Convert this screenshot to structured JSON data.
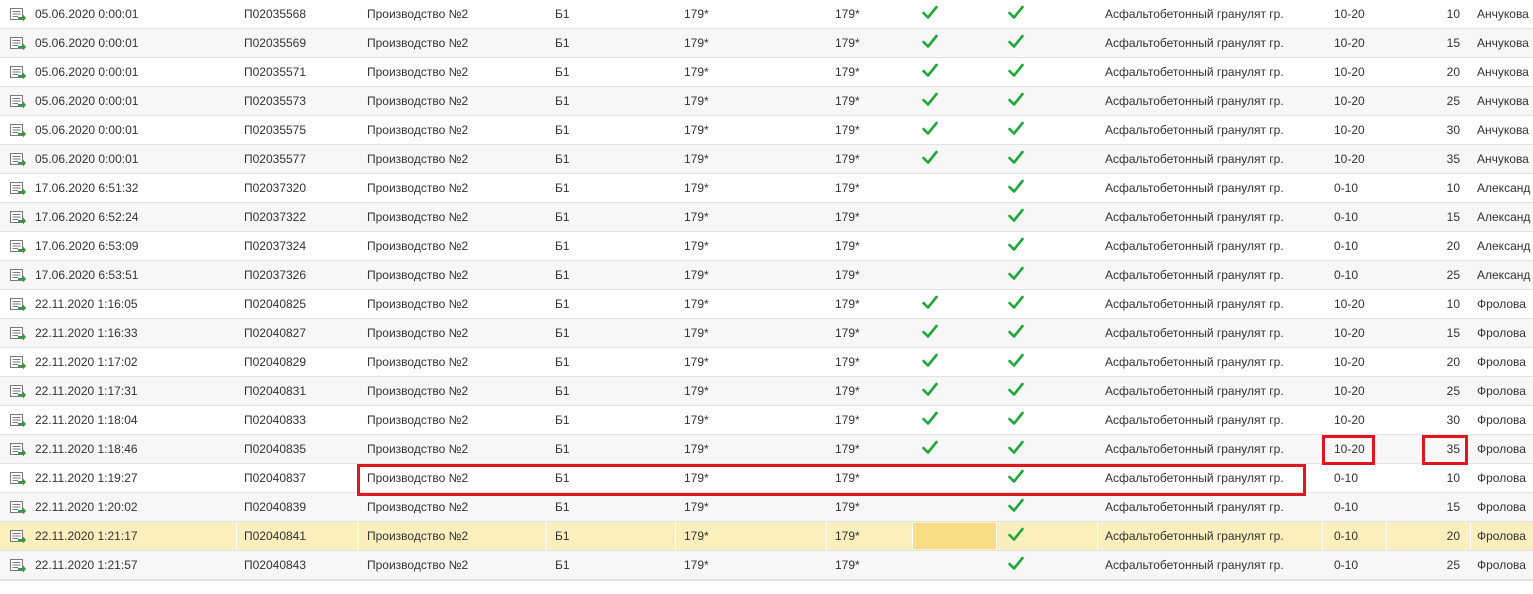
{
  "colors": {
    "check": "#1fa83a",
    "highlight": "#e0161e",
    "selected_row": "#fbefbd",
    "yellow_cell": "#f9dc86"
  },
  "row_icon": "document-arrow-icon",
  "check_icon": "checkmark-icon",
  "rows": [
    {
      "date": "05.06.2020 0:00:01",
      "num": "П02035568",
      "prod": "Производство №2",
      "b": "Б1",
      "a": "179*",
      "c": "179*",
      "chk1": true,
      "chk2": true,
      "mat": "Асфальтобетонный гранулят гр.",
      "fr": "10-20",
      "qty": "10",
      "name": "Анчукова"
    },
    {
      "date": "05.06.2020 0:00:01",
      "num": "П02035569",
      "prod": "Производство №2",
      "b": "Б1",
      "a": "179*",
      "c": "179*",
      "chk1": true,
      "chk2": true,
      "mat": "Асфальтобетонный гранулят гр.",
      "fr": "10-20",
      "qty": "15",
      "name": "Анчукова"
    },
    {
      "date": "05.06.2020 0:00:01",
      "num": "П02035571",
      "prod": "Производство №2",
      "b": "Б1",
      "a": "179*",
      "c": "179*",
      "chk1": true,
      "chk2": true,
      "mat": "Асфальтобетонный гранулят гр.",
      "fr": "10-20",
      "qty": "20",
      "name": "Анчукова"
    },
    {
      "date": "05.06.2020 0:00:01",
      "num": "П02035573",
      "prod": "Производство №2",
      "b": "Б1",
      "a": "179*",
      "c": "179*",
      "chk1": true,
      "chk2": true,
      "mat": "Асфальтобетонный гранулят гр.",
      "fr": "10-20",
      "qty": "25",
      "name": "Анчукова"
    },
    {
      "date": "05.06.2020 0:00:01",
      "num": "П02035575",
      "prod": "Производство №2",
      "b": "Б1",
      "a": "179*",
      "c": "179*",
      "chk1": true,
      "chk2": true,
      "mat": "Асфальтобетонный гранулят гр.",
      "fr": "10-20",
      "qty": "30",
      "name": "Анчукова"
    },
    {
      "date": "05.06.2020 0:00:01",
      "num": "П02035577",
      "prod": "Производство №2",
      "b": "Б1",
      "a": "179*",
      "c": "179*",
      "chk1": true,
      "chk2": true,
      "mat": "Асфальтобетонный гранулят гр.",
      "fr": "10-20",
      "qty": "35",
      "name": "Анчукова"
    },
    {
      "date": "17.06.2020 6:51:32",
      "num": "П02037320",
      "prod": "Производство №2",
      "b": "Б1",
      "a": "179*",
      "c": "179*",
      "chk1": false,
      "chk2": true,
      "mat": "Асфальтобетонный гранулят гр.",
      "fr": "0-10",
      "qty": "10",
      "name": "Александ"
    },
    {
      "date": "17.06.2020 6:52:24",
      "num": "П02037322",
      "prod": "Производство №2",
      "b": "Б1",
      "a": "179*",
      "c": "179*",
      "chk1": false,
      "chk2": true,
      "mat": "Асфальтобетонный гранулят гр.",
      "fr": "0-10",
      "qty": "15",
      "name": "Александ"
    },
    {
      "date": "17.06.2020 6:53:09",
      "num": "П02037324",
      "prod": "Производство №2",
      "b": "Б1",
      "a": "179*",
      "c": "179*",
      "chk1": false,
      "chk2": true,
      "mat": "Асфальтобетонный гранулят гр.",
      "fr": "0-10",
      "qty": "20",
      "name": "Александ"
    },
    {
      "date": "17.06.2020 6:53:51",
      "num": "П02037326",
      "prod": "Производство №2",
      "b": "Б1",
      "a": "179*",
      "c": "179*",
      "chk1": false,
      "chk2": true,
      "mat": "Асфальтобетонный гранулят гр.",
      "fr": "0-10",
      "qty": "25",
      "name": "Александ"
    },
    {
      "date": "22.11.2020 1:16:05",
      "num": "П02040825",
      "prod": "Производство №2",
      "b": "Б1",
      "a": "179*",
      "c": "179*",
      "chk1": true,
      "chk2": true,
      "mat": "Асфальтобетонный гранулят гр.",
      "fr": "10-20",
      "qty": "10",
      "name": "Фролова"
    },
    {
      "date": "22.11.2020 1:16:33",
      "num": "П02040827",
      "prod": "Производство №2",
      "b": "Б1",
      "a": "179*",
      "c": "179*",
      "chk1": true,
      "chk2": true,
      "mat": "Асфальтобетонный гранулят гр.",
      "fr": "10-20",
      "qty": "15",
      "name": "Фролова"
    },
    {
      "date": "22.11.2020 1:17:02",
      "num": "П02040829",
      "prod": "Производство №2",
      "b": "Б1",
      "a": "179*",
      "c": "179*",
      "chk1": true,
      "chk2": true,
      "mat": "Асфальтобетонный гранулят гр.",
      "fr": "10-20",
      "qty": "20",
      "name": "Фролова"
    },
    {
      "date": "22.11.2020 1:17:31",
      "num": "П02040831",
      "prod": "Производство №2",
      "b": "Б1",
      "a": "179*",
      "c": "179*",
      "chk1": true,
      "chk2": true,
      "mat": "Асфальтобетонный гранулят гр.",
      "fr": "10-20",
      "qty": "25",
      "name": "Фролова"
    },
    {
      "date": "22.11.2020 1:18:04",
      "num": "П02040833",
      "prod": "Производство №2",
      "b": "Б1",
      "a": "179*",
      "c": "179*",
      "chk1": true,
      "chk2": true,
      "mat": "Асфальтобетонный гранулят гр.",
      "fr": "10-20",
      "qty": "30",
      "name": "Фролова"
    },
    {
      "date": "22.11.2020 1:18:46",
      "num": "П02040835",
      "prod": "Производство №2",
      "b": "Б1",
      "a": "179*",
      "c": "179*",
      "chk1": true,
      "chk2": true,
      "mat": "Асфальтобетонный гранулят гр.",
      "fr": "10-20",
      "qty": "35",
      "name": "Фролова"
    },
    {
      "date": "22.11.2020 1:19:27",
      "num": "П02040837",
      "prod": "Производство №2",
      "b": "Б1",
      "a": "179*",
      "c": "179*",
      "chk1": false,
      "chk2": true,
      "mat": "Асфальтобетонный гранулят гр.",
      "fr": "0-10",
      "qty": "10",
      "name": "Фролова"
    },
    {
      "date": "22.11.2020 1:20:02",
      "num": "П02040839",
      "prod": "Производство №2",
      "b": "Б1",
      "a": "179*",
      "c": "179*",
      "chk1": false,
      "chk2": true,
      "mat": "Асфальтобетонный гранулят гр.",
      "fr": "0-10",
      "qty": "15",
      "name": "Фролова"
    },
    {
      "date": "22.11.2020 1:21:17",
      "num": "П02040841",
      "prod": "Производство №2",
      "b": "Б1",
      "a": "179*",
      "c": "179*",
      "chk1": false,
      "chk2": true,
      "mat": "Асфальтобетонный гранулят гр.",
      "fr": "0-10",
      "qty": "20",
      "name": "Фролова",
      "selected": true
    },
    {
      "date": "22.11.2020 1:21:57",
      "num": "П02040843",
      "prod": "Производство №2",
      "b": "Б1",
      "a": "179*",
      "c": "179*",
      "chk1": false,
      "chk2": true,
      "mat": "Асфальтобетонный гранулят гр.",
      "fr": "0-10",
      "qty": "25",
      "name": "Фролова"
    }
  ]
}
